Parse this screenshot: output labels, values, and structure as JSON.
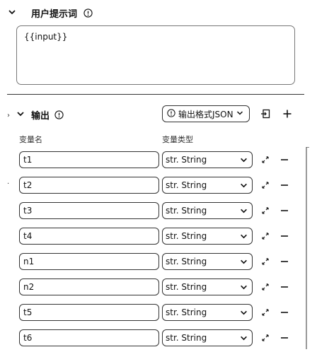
{
  "prompt_section": {
    "title": "用户提示词",
    "text": "{{input}}"
  },
  "output_section": {
    "title": "输出",
    "format_button": "输出格式JSON",
    "col_name": "变量名",
    "col_type": "变量类型",
    "rows": [
      {
        "name": "t1",
        "type": "str. String"
      },
      {
        "name": "t2",
        "type": "str. String"
      },
      {
        "name": "t3",
        "type": "str. String"
      },
      {
        "name": "t4",
        "type": "str. String"
      },
      {
        "name": "n1",
        "type": "str. String"
      },
      {
        "name": "n2",
        "type": "str. String"
      },
      {
        "name": "t5",
        "type": "str. String"
      },
      {
        "name": "t6",
        "type": "str. String"
      }
    ]
  }
}
